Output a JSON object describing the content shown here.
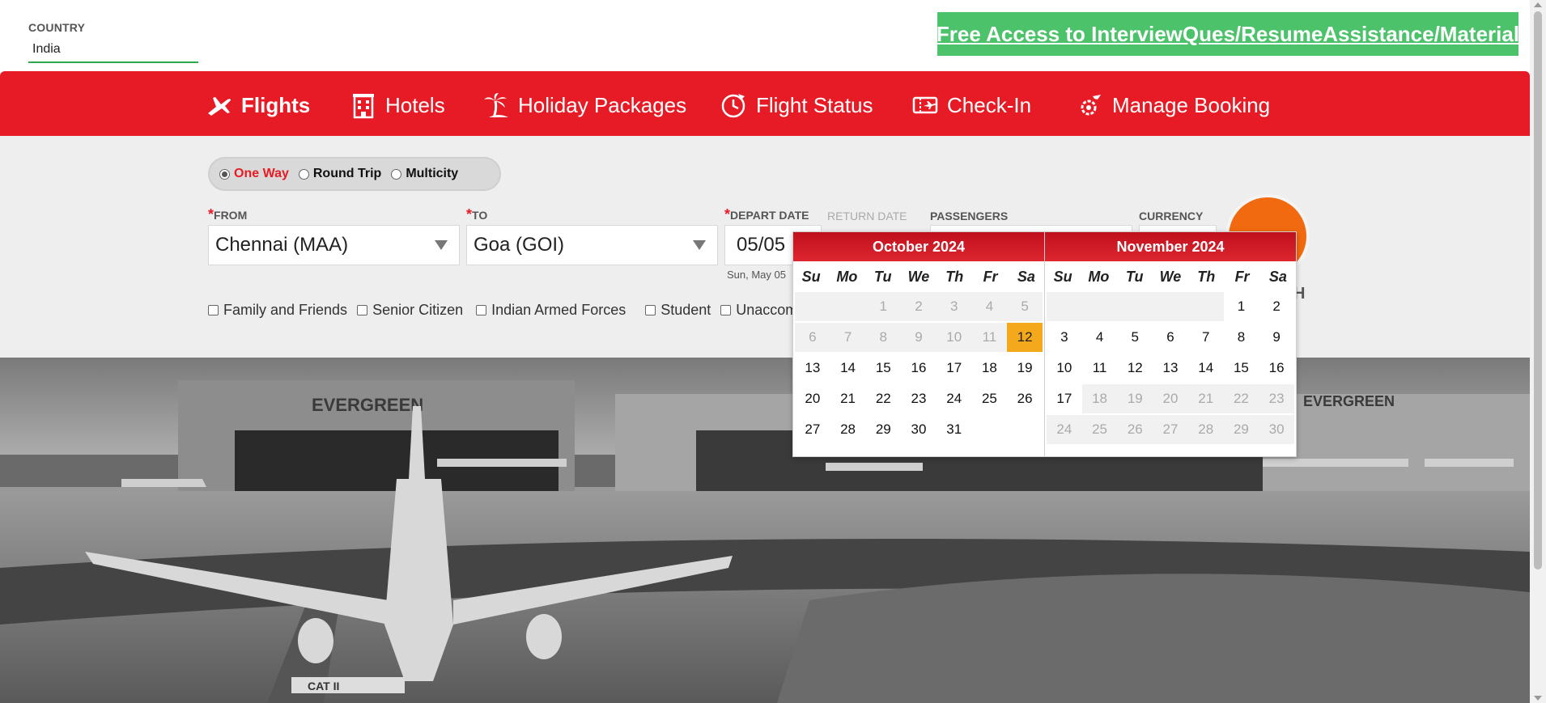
{
  "country": {
    "label": "COUNTRY",
    "value": "India"
  },
  "promo": {
    "text": "Free Access to InterviewQues/ResumeAssistance/Material",
    "color": "#4cc36b"
  },
  "nav": {
    "accent": "#e71b25",
    "items": [
      {
        "label": "Flights",
        "icon": "plane-icon",
        "active": true
      },
      {
        "label": "Hotels",
        "icon": "hotel-building-icon"
      },
      {
        "label": "Holiday Packages",
        "icon": "palm-tree-icon"
      },
      {
        "label": "Flight Status",
        "icon": "clock-plane-icon"
      },
      {
        "label": "Check-In",
        "icon": "ticket-icon"
      },
      {
        "label": "Manage Booking",
        "icon": "gear-plane-icon"
      }
    ]
  },
  "trip": {
    "options": [
      "One Way",
      "Round Trip",
      "Multicity"
    ],
    "selected": "One Way"
  },
  "form": {
    "from_label": "FROM",
    "from_value": "Chennai (MAA)",
    "to_label": "TO",
    "to_value": "Goa (GOI)",
    "depart_label": "DEPART DATE",
    "depart_value": "05/05",
    "depart_sub": "Sun, May 05",
    "return_label": "RETURN DATE",
    "passengers_label": "PASSENGERS",
    "currency_label": "CURRENCY",
    "search_partial": "H",
    "search_color": "#f26a0f"
  },
  "discounts": [
    "Family and Friends",
    "Senior Citizen",
    "Indian Armed Forces",
    "Student",
    "Unaccom"
  ],
  "calendar": {
    "weekdays": [
      "Su",
      "Mo",
      "Tu",
      "We",
      "Th",
      "Fr",
      "Sa"
    ],
    "months": [
      {
        "title": "October 2024",
        "cells": [
          {
            "d": "",
            "s": "blank-dis"
          },
          {
            "d": "",
            "s": "blank-dis"
          },
          {
            "d": "1",
            "s": "dis"
          },
          {
            "d": "2",
            "s": "dis"
          },
          {
            "d": "3",
            "s": "dis"
          },
          {
            "d": "4",
            "s": "dis"
          },
          {
            "d": "5",
            "s": "dis"
          },
          {
            "d": "6",
            "s": "dis"
          },
          {
            "d": "7",
            "s": "dis"
          },
          {
            "d": "8",
            "s": "dis"
          },
          {
            "d": "9",
            "s": "dis"
          },
          {
            "d": "10",
            "s": "dis"
          },
          {
            "d": "11",
            "s": "dis"
          },
          {
            "d": "12",
            "s": "today"
          },
          {
            "d": "13",
            "s": "on"
          },
          {
            "d": "14",
            "s": "on"
          },
          {
            "d": "15",
            "s": "on"
          },
          {
            "d": "16",
            "s": "on"
          },
          {
            "d": "17",
            "s": "on"
          },
          {
            "d": "18",
            "s": "on"
          },
          {
            "d": "19",
            "s": "on"
          },
          {
            "d": "20",
            "s": "on"
          },
          {
            "d": "21",
            "s": "on"
          },
          {
            "d": "22",
            "s": "on"
          },
          {
            "d": "23",
            "s": "on"
          },
          {
            "d": "24",
            "s": "on"
          },
          {
            "d": "25",
            "s": "on"
          },
          {
            "d": "26",
            "s": "on"
          },
          {
            "d": "27",
            "s": "on"
          },
          {
            "d": "28",
            "s": "on"
          },
          {
            "d": "29",
            "s": "on"
          },
          {
            "d": "30",
            "s": "on"
          },
          {
            "d": "31",
            "s": "on"
          },
          {
            "d": "",
            "s": "blank"
          },
          {
            "d": "",
            "s": "blank"
          }
        ]
      },
      {
        "title": "November 2024",
        "cells": [
          {
            "d": "",
            "s": "blank-dis"
          },
          {
            "d": "",
            "s": "blank-dis"
          },
          {
            "d": "",
            "s": "blank-dis"
          },
          {
            "d": "",
            "s": "blank-dis"
          },
          {
            "d": "",
            "s": "blank-dis"
          },
          {
            "d": "1",
            "s": "on"
          },
          {
            "d": "2",
            "s": "on"
          },
          {
            "d": "3",
            "s": "on"
          },
          {
            "d": "4",
            "s": "on"
          },
          {
            "d": "5",
            "s": "on"
          },
          {
            "d": "6",
            "s": "on"
          },
          {
            "d": "7",
            "s": "on"
          },
          {
            "d": "8",
            "s": "on"
          },
          {
            "d": "9",
            "s": "on"
          },
          {
            "d": "10",
            "s": "on"
          },
          {
            "d": "11",
            "s": "on"
          },
          {
            "d": "12",
            "s": "on"
          },
          {
            "d": "13",
            "s": "on"
          },
          {
            "d": "14",
            "s": "on"
          },
          {
            "d": "15",
            "s": "on"
          },
          {
            "d": "16",
            "s": "on"
          },
          {
            "d": "17",
            "s": "on"
          },
          {
            "d": "18",
            "s": "dis"
          },
          {
            "d": "19",
            "s": "dis"
          },
          {
            "d": "20",
            "s": "dis"
          },
          {
            "d": "21",
            "s": "dis"
          },
          {
            "d": "22",
            "s": "dis"
          },
          {
            "d": "23",
            "s": "dis"
          },
          {
            "d": "24",
            "s": "dis"
          },
          {
            "d": "25",
            "s": "dis"
          },
          {
            "d": "26",
            "s": "dis"
          },
          {
            "d": "27",
            "s": "dis"
          },
          {
            "d": "28",
            "s": "dis"
          },
          {
            "d": "29",
            "s": "dis"
          },
          {
            "d": "30",
            "s": "dis"
          }
        ]
      }
    ]
  },
  "hero": {
    "sign_text": "EVERGREEN",
    "runway_text": "CAT II"
  }
}
